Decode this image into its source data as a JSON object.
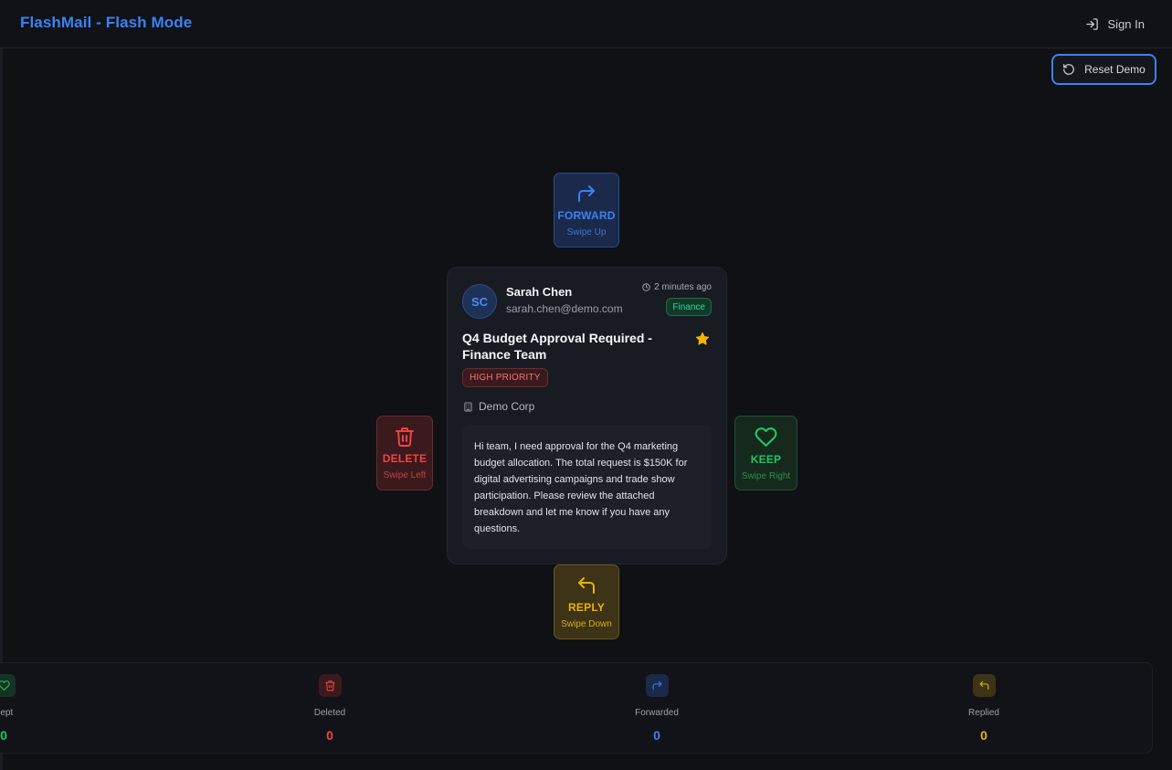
{
  "app": {
    "title": "FlashMail - Flash Mode"
  },
  "header": {
    "signin_label": "Sign In"
  },
  "toolbar": {
    "reset_label": "Reset Demo"
  },
  "actions": {
    "forward": {
      "label": "FORWARD",
      "hint": "Swipe Up"
    },
    "delete": {
      "label": "DELETE",
      "hint": "Swipe Left"
    },
    "keep": {
      "label": "KEEP",
      "hint": "Swipe Right"
    },
    "reply": {
      "label": "REPLY",
      "hint": "Swipe Down"
    }
  },
  "email": {
    "initials": "SC",
    "sender_name": "Sarah Chen",
    "sender_email": "sarah.chen@demo.com",
    "time": "2 minutes ago",
    "category": "Finance",
    "subject": "Q4 Budget Approval Required - Finance Team",
    "priority": "HIGH PRIORITY",
    "company": "Demo Corp",
    "body": "Hi team, I need approval for the Q4 marketing budget allocation. The total request is $150K for digital advertising campaigns and trade show participation. Please review the attached breakdown and let me know if you have any questions."
  },
  "stats": {
    "kept": {
      "label": "Kept",
      "count": "0"
    },
    "deleted": {
      "label": "Deleted",
      "count": "0"
    },
    "forwarded": {
      "label": "Forwarded",
      "count": "0"
    },
    "replied": {
      "label": "Replied",
      "count": "0"
    }
  },
  "colors": {
    "accent": "#3b82f6",
    "delete": "#ef4444",
    "keep": "#22c55e",
    "reply": "#eab308"
  }
}
